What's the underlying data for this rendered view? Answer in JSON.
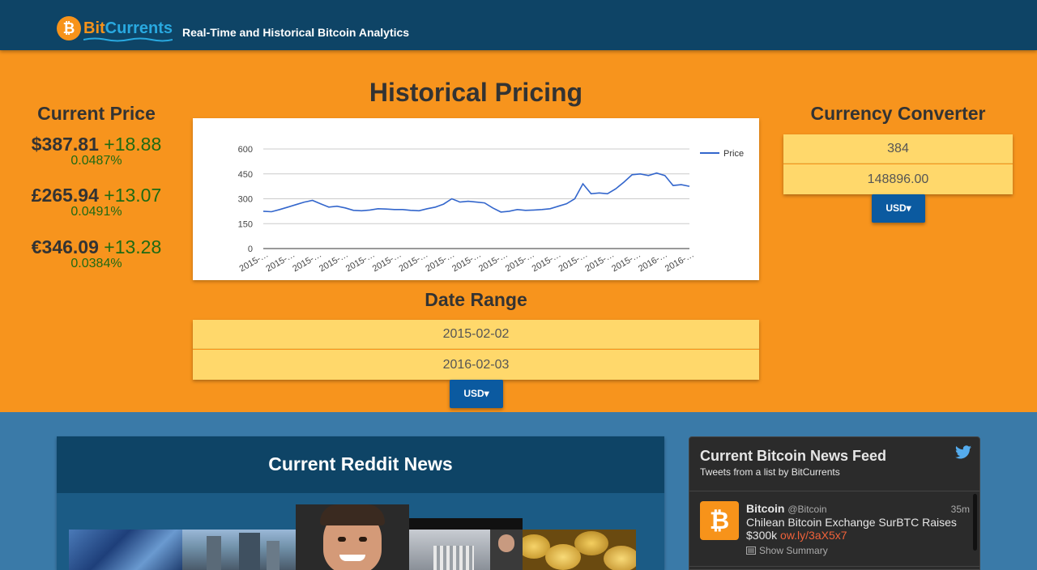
{
  "header": {
    "logo_bit": "Bit",
    "logo_currents": "Currents",
    "tagline": "Real-Time and Historical Bitcoin Analytics"
  },
  "current_price": {
    "title": "Current Price",
    "items": [
      {
        "price": "$387.81",
        "change": "+18.88",
        "percent": "0.0487%"
      },
      {
        "price": "£265.94",
        "change": "+13.07",
        "percent": "0.0491%"
      },
      {
        "price": "€346.09",
        "change": "+13.28",
        "percent": "0.0384%"
      }
    ]
  },
  "historical": {
    "title": "Historical Pricing",
    "chart_data": {
      "type": "line",
      "title": "",
      "xlabel": "",
      "ylabel": "",
      "ylim": [
        0,
        600
      ],
      "yticks": [
        0,
        150,
        300,
        450,
        600
      ],
      "grid": true,
      "legend": "right",
      "x_tick_labels": [
        "2015-…",
        "2015-…",
        "2015-…",
        "2015-…",
        "2015-…",
        "2015-…",
        "2015-…",
        "2015-…",
        "2015-…",
        "2015-…",
        "2015-…",
        "2015-…",
        "2015-…",
        "2015-…",
        "2015-…",
        "2016-…",
        "2016-…"
      ],
      "series": [
        {
          "name": "Price",
          "color": "#3366cc",
          "x": [
            "2015-02-02",
            "2015-02-09",
            "2015-02-16",
            "2015-02-23",
            "2015-03-02",
            "2015-03-09",
            "2015-03-16",
            "2015-03-23",
            "2015-03-30",
            "2015-04-06",
            "2015-04-13",
            "2015-04-20",
            "2015-04-27",
            "2015-05-04",
            "2015-05-11",
            "2015-05-18",
            "2015-05-25",
            "2015-06-01",
            "2015-06-08",
            "2015-06-15",
            "2015-06-22",
            "2015-06-29",
            "2015-07-06",
            "2015-07-13",
            "2015-07-20",
            "2015-07-27",
            "2015-08-03",
            "2015-08-10",
            "2015-08-17",
            "2015-08-24",
            "2015-08-31",
            "2015-09-07",
            "2015-09-14",
            "2015-09-21",
            "2015-09-28",
            "2015-10-05",
            "2015-10-12",
            "2015-10-19",
            "2015-10-26",
            "2015-11-02",
            "2015-11-09",
            "2015-11-16",
            "2015-11-23",
            "2015-11-30",
            "2015-12-07",
            "2015-12-14",
            "2015-12-21",
            "2015-12-28",
            "2016-01-04",
            "2016-01-11",
            "2016-01-18",
            "2016-01-25",
            "2016-02-03"
          ],
          "values": [
            225,
            222,
            235,
            250,
            265,
            280,
            290,
            270,
            250,
            255,
            245,
            230,
            228,
            232,
            240,
            238,
            235,
            235,
            230,
            228,
            240,
            250,
            268,
            300,
            280,
            285,
            280,
            275,
            245,
            220,
            225,
            235,
            230,
            232,
            235,
            240,
            255,
            270,
            300,
            390,
            330,
            335,
            330,
            360,
            400,
            445,
            450,
            440,
            455,
            440,
            380,
            385,
            375
          ]
        }
      ]
    }
  },
  "date_range": {
    "title": "Date Range",
    "start": "2015-02-02",
    "end": "2016-02-03",
    "currency_button": "USD"
  },
  "converter": {
    "title": "Currency Converter",
    "btc_value": "384",
    "fiat_value": "148896.00",
    "currency_button": "USD"
  },
  "reddit": {
    "title": "Current Reddit News"
  },
  "twitter": {
    "title": "Current Bitcoin News Feed",
    "subtitle": "Tweets from a list by BitCurrents",
    "tweet": {
      "name": "Bitcoin",
      "handle": "@Bitcoin",
      "time": "35m",
      "text": "Chilean Bitcoin Exchange SurBTC Raises $300k",
      "link": "ow.ly/3aX5x7",
      "summary": "Show Summary"
    }
  }
}
